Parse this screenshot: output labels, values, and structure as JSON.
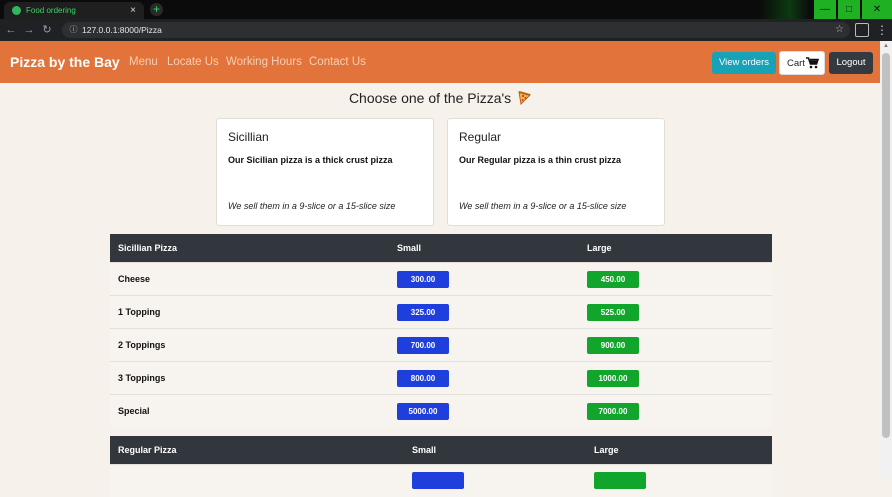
{
  "browser": {
    "tab_title": "Food ordering",
    "tab_close": "×",
    "new_tab": "+",
    "url": "127.0.0.1:8000/Pizza",
    "win_min": "—",
    "win_max": "□",
    "win_close": "✕"
  },
  "navbar": {
    "brand": "Pizza by the Bay",
    "links": [
      "Menu",
      "Locate Us",
      "Working Hours",
      "Contact Us"
    ],
    "view_orders": "View orders",
    "cart": "Cart",
    "logout": "Logout"
  },
  "heading": "Choose one of the Pizza's",
  "cards": [
    {
      "title": "Sicillian",
      "desc": "Our Sicilian pizza is a thick crust pizza",
      "sizes": "We sell them in a 9-slice or a 15-slice size"
    },
    {
      "title": "Regular",
      "desc": "Our Regular pizza is a thin crust pizza",
      "sizes": "We sell them in a 9-slice or a 15-slice size"
    }
  ],
  "sicilian_table": {
    "headers": [
      "Sicillian Pizza",
      "Small",
      "Large"
    ],
    "rows": [
      {
        "name": "Cheese",
        "small": "300.00",
        "large": "450.00"
      },
      {
        "name": "1 Topping",
        "small": "325.00",
        "large": "525.00"
      },
      {
        "name": "2 Toppings",
        "small": "700.00",
        "large": "900.00"
      },
      {
        "name": "3 Toppings",
        "small": "800.00",
        "large": "1000.00"
      },
      {
        "name": "Special",
        "small": "5000.00",
        "large": "7000.00"
      }
    ]
  },
  "regular_table": {
    "headers": [
      "Regular Pizza",
      "Small",
      "Large"
    ]
  },
  "colors": {
    "navbar": "#e2743b",
    "small_price": "#1f3fdc",
    "large_price": "#11a52b",
    "table_header": "#32373d",
    "view_orders": "#17a2b8"
  }
}
